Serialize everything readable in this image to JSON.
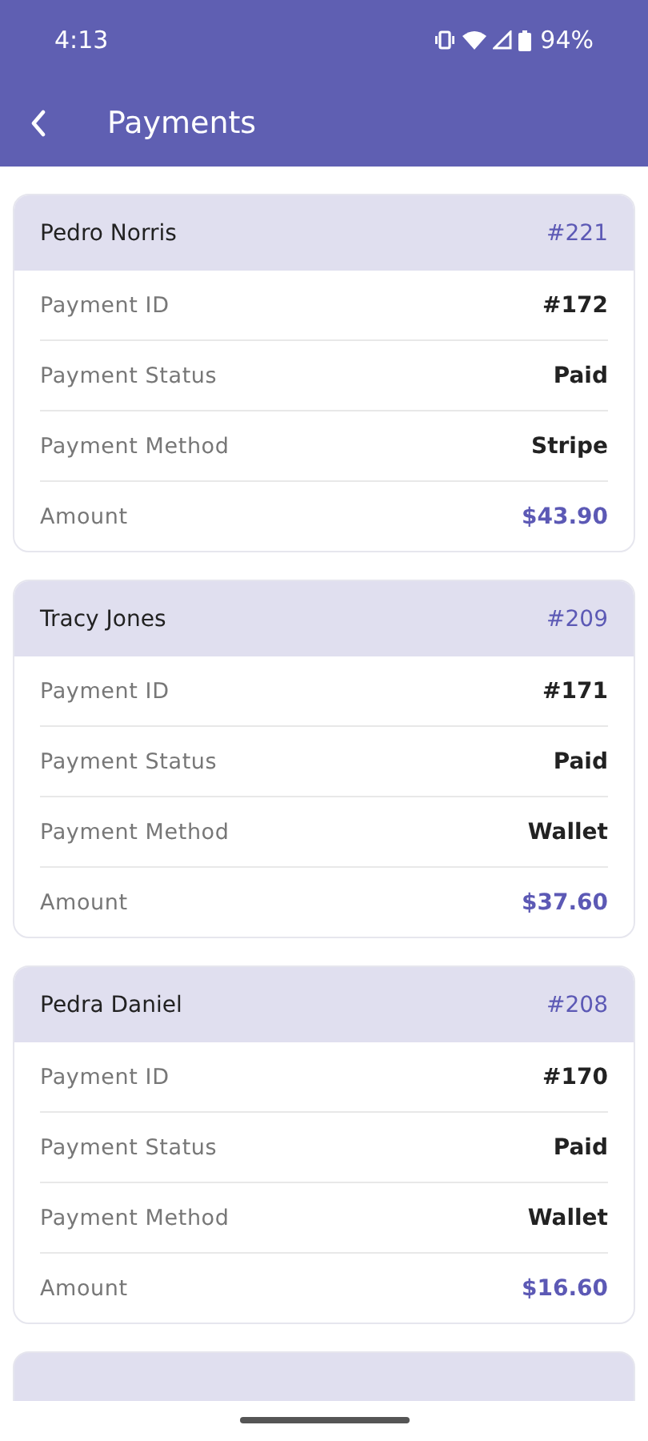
{
  "status_bar": {
    "time": "4:13",
    "battery": "94%"
  },
  "app_bar": {
    "title": "Payments"
  },
  "payments": [
    {
      "customer": "Pedro Norris",
      "order": "#221",
      "rows": [
        {
          "label": "Payment ID",
          "value": "#172",
          "kind": "plain"
        },
        {
          "label": "Payment Status",
          "value": "Paid",
          "kind": "plain"
        },
        {
          "label": "Payment Method",
          "value": "Stripe",
          "kind": "plain"
        },
        {
          "label": "Amount",
          "value": "$43.90",
          "kind": "amount"
        }
      ]
    },
    {
      "customer": "Tracy Jones",
      "order": "#209",
      "rows": [
        {
          "label": "Payment ID",
          "value": "#171",
          "kind": "plain"
        },
        {
          "label": "Payment Status",
          "value": "Paid",
          "kind": "plain"
        },
        {
          "label": "Payment Method",
          "value": "Wallet",
          "kind": "plain"
        },
        {
          "label": "Amount",
          "value": "$37.60",
          "kind": "amount"
        }
      ]
    },
    {
      "customer": "Pedra Daniel",
      "order": "#208",
      "rows": [
        {
          "label": "Payment ID",
          "value": "#170",
          "kind": "plain"
        },
        {
          "label": "Payment Status",
          "value": "Paid",
          "kind": "plain"
        },
        {
          "label": "Payment Method",
          "value": "Wallet",
          "kind": "plain"
        },
        {
          "label": "Amount",
          "value": "$16.60",
          "kind": "amount"
        }
      ]
    }
  ]
}
